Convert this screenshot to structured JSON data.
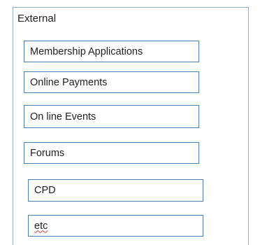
{
  "panel": {
    "title": "External",
    "items": [
      {
        "label": "Membership Applications"
      },
      {
        "label": "Online Payments"
      },
      {
        "label": "On line Events"
      },
      {
        "label": "Forums"
      },
      {
        "label": "CPD"
      },
      {
        "label": "etc"
      }
    ]
  },
  "colors": {
    "frame_border": "#8fb2cf",
    "box_border": "#4a7fb0",
    "spellcheck_underline": "#d04040"
  }
}
